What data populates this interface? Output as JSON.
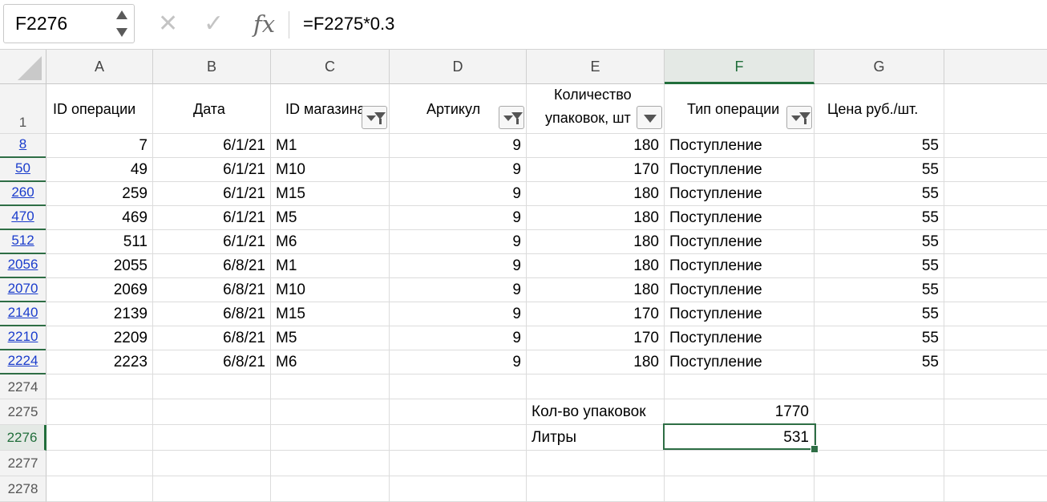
{
  "formula_bar": {
    "name_box": "F2276",
    "cancel_icon": "x-icon",
    "enter_icon": "check-icon",
    "fx_label": "fx",
    "formula": "=F2275*0.3"
  },
  "columns": [
    "A",
    "B",
    "C",
    "D",
    "E",
    "F",
    "G"
  ],
  "selected_column": "F",
  "header_row": {
    "row_number": "1",
    "a": "ID операции",
    "b": "Дата",
    "c": "ID магазина",
    "d": "Артикул",
    "e_line1": "Количество",
    "e_line2": "упаковок, шт",
    "f": "Тип операции",
    "g": "Цена руб./шт."
  },
  "rows": [
    {
      "row": "8",
      "a": "7",
      "b": "6/1/21",
      "c": "M1",
      "d": "9",
      "e": "180",
      "f": "Поступление",
      "g": "55"
    },
    {
      "row": "50",
      "a": "49",
      "b": "6/1/21",
      "c": "M10",
      "d": "9",
      "e": "170",
      "f": "Поступление",
      "g": "55"
    },
    {
      "row": "260",
      "a": "259",
      "b": "6/1/21",
      "c": "M15",
      "d": "9",
      "e": "180",
      "f": "Поступление",
      "g": "55"
    },
    {
      "row": "470",
      "a": "469",
      "b": "6/1/21",
      "c": "M5",
      "d": "9",
      "e": "180",
      "f": "Поступление",
      "g": "55"
    },
    {
      "row": "512",
      "a": "511",
      "b": "6/1/21",
      "c": "M6",
      "d": "9",
      "e": "180",
      "f": "Поступление",
      "g": "55"
    },
    {
      "row": "2056",
      "a": "2055",
      "b": "6/8/21",
      "c": "M1",
      "d": "9",
      "e": "180",
      "f": "Поступление",
      "g": "55"
    },
    {
      "row": "2070",
      "a": "2069",
      "b": "6/8/21",
      "c": "M10",
      "d": "9",
      "e": "180",
      "f": "Поступление",
      "g": "55"
    },
    {
      "row": "2140",
      "a": "2139",
      "b": "6/8/21",
      "c": "M15",
      "d": "9",
      "e": "170",
      "f": "Поступление",
      "g": "55"
    },
    {
      "row": "2210",
      "a": "2209",
      "b": "6/8/21",
      "c": "M5",
      "d": "9",
      "e": "170",
      "f": "Поступление",
      "g": "55"
    },
    {
      "row": "2224",
      "a": "2223",
      "b": "6/8/21",
      "c": "M6",
      "d": "9",
      "e": "180",
      "f": "Поступление",
      "g": "55"
    }
  ],
  "extra_rows": [
    {
      "row": "2274",
      "e": "",
      "f": ""
    },
    {
      "row": "2275",
      "e": "Кол-во упаковок",
      "f": "1770"
    },
    {
      "row": "2276",
      "e": "Литры",
      "f": "531"
    },
    {
      "row": "2277",
      "e": "",
      "f": ""
    },
    {
      "row": "2278",
      "e": "",
      "f": ""
    }
  ],
  "active_cell": "F2276",
  "colors": {
    "selection": "#2e6e45",
    "filtered_row_number": "#1a3ccc"
  }
}
